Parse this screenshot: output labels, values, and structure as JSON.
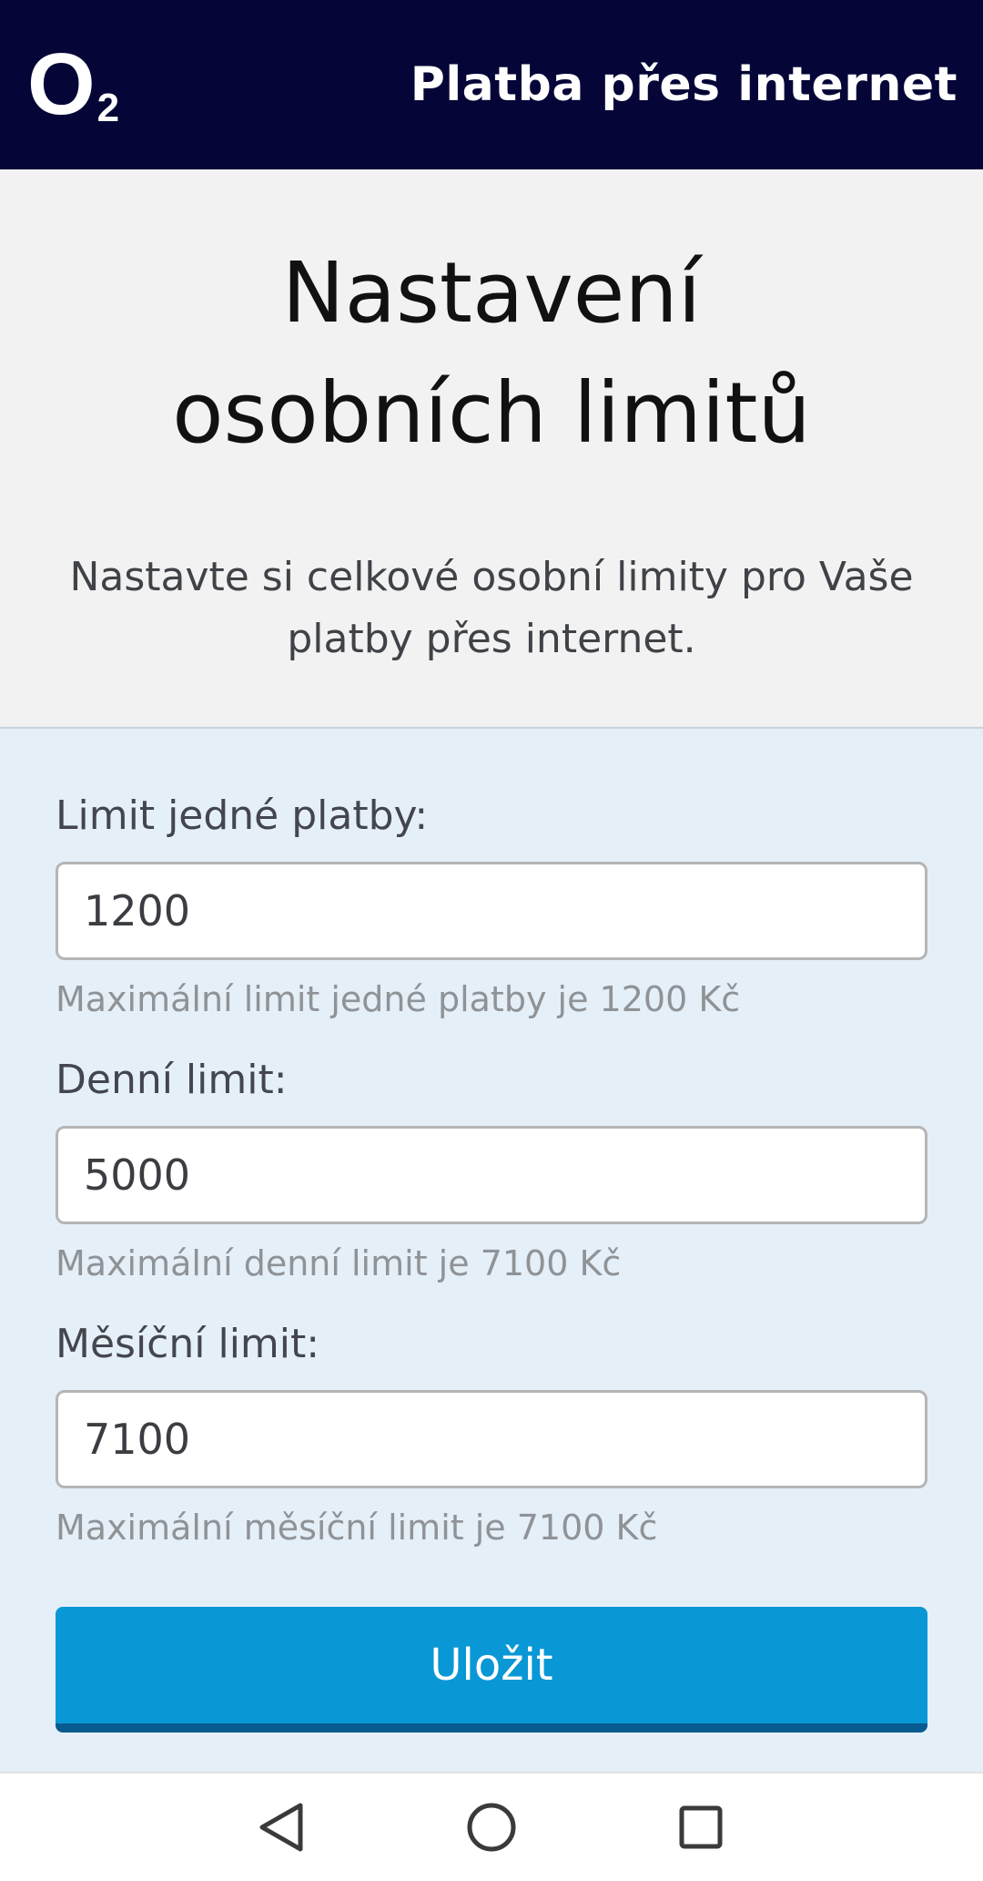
{
  "header": {
    "logo_main": "O",
    "logo_sub": "2",
    "title": "Platba přes internet"
  },
  "intro": {
    "title": "Nastavení osobních limitů",
    "description": "Nastavte si celkové osobní limity pro Vaše platby přes internet."
  },
  "form": {
    "fields": [
      {
        "label": "Limit jedné platby:",
        "value": "1200",
        "hint": "Maximální limit jedné platby je 1200 Kč"
      },
      {
        "label": "Denní limit:",
        "value": "5000",
        "hint": "Maximální denní limit je 7100 Kč"
      },
      {
        "label": "Měsíční limit:",
        "value": "7100",
        "hint": "Maximální měsíční limit je 7100 Kč"
      }
    ],
    "save_label": "Uložit"
  },
  "navbar": {
    "back_icon": "back-triangle-icon",
    "home_icon": "home-circle-icon",
    "recents_icon": "recents-square-icon"
  },
  "colors": {
    "header_bg": "#050637",
    "intro_bg": "#f2f2f2",
    "form_bg": "#e5eff8",
    "button_bg": "#0a97d5",
    "button_shadow": "#085b8e"
  }
}
